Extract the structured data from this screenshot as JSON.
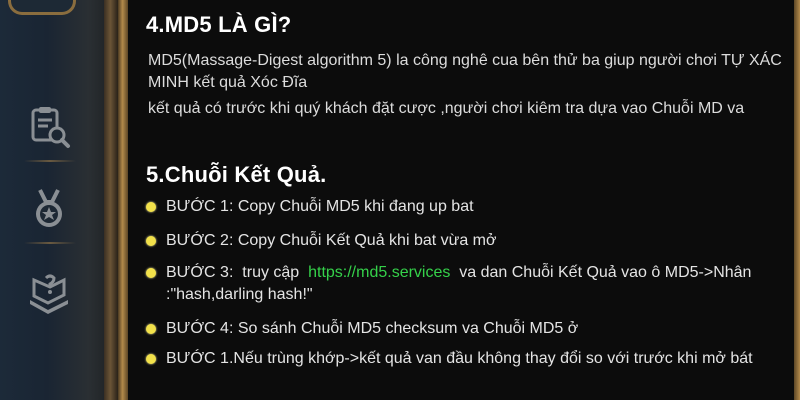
{
  "section4": {
    "title": "4.MD5 LÀ GÌ?",
    "para1": "MD5(Massage-Digest algorithm 5) la công nghê cua bên thử ba giup người chơi TỰ XÁC MINH kết quả Xóc Đĩa",
    "para2": "kết quả có trước khi quý khách đặt cược ,người chơi kiêm tra dựa vao Chuỗi MD va"
  },
  "section5": {
    "title": "5.Chuỗi Kết Quả.",
    "steps": [
      {
        "text": "BƯỚC 1:  Copy Chuỗi MD5 khi đang up bat"
      },
      {
        "text": "BƯỚC 2:  Copy Chuỗi Kết Quả khi bat vừa mở"
      },
      {
        "pre": "BƯỚC 3:  truy cập  ",
        "link": "https://md5.services",
        "post": "  va dan Chuỗi Kết Quả vao ô MD5->Nhân :\"hash,darling hash!\""
      },
      {
        "text": "BƯỚC 4:  So sánh Chuỗi MD5 checksum  va Chuỗi MD5 ở"
      },
      {
        "text": "BƯỚC 1.Nếu trùng khớp->kết quả van đầu không thay đổi so với trước khi mở bát"
      }
    ]
  },
  "nav": {
    "icons": [
      "clipboard-search-icon",
      "medal-icon",
      "book-icon"
    ]
  },
  "colors": {
    "link": "#35d14a",
    "bullet": "#f2e14a",
    "frame": "#b38a4a"
  }
}
